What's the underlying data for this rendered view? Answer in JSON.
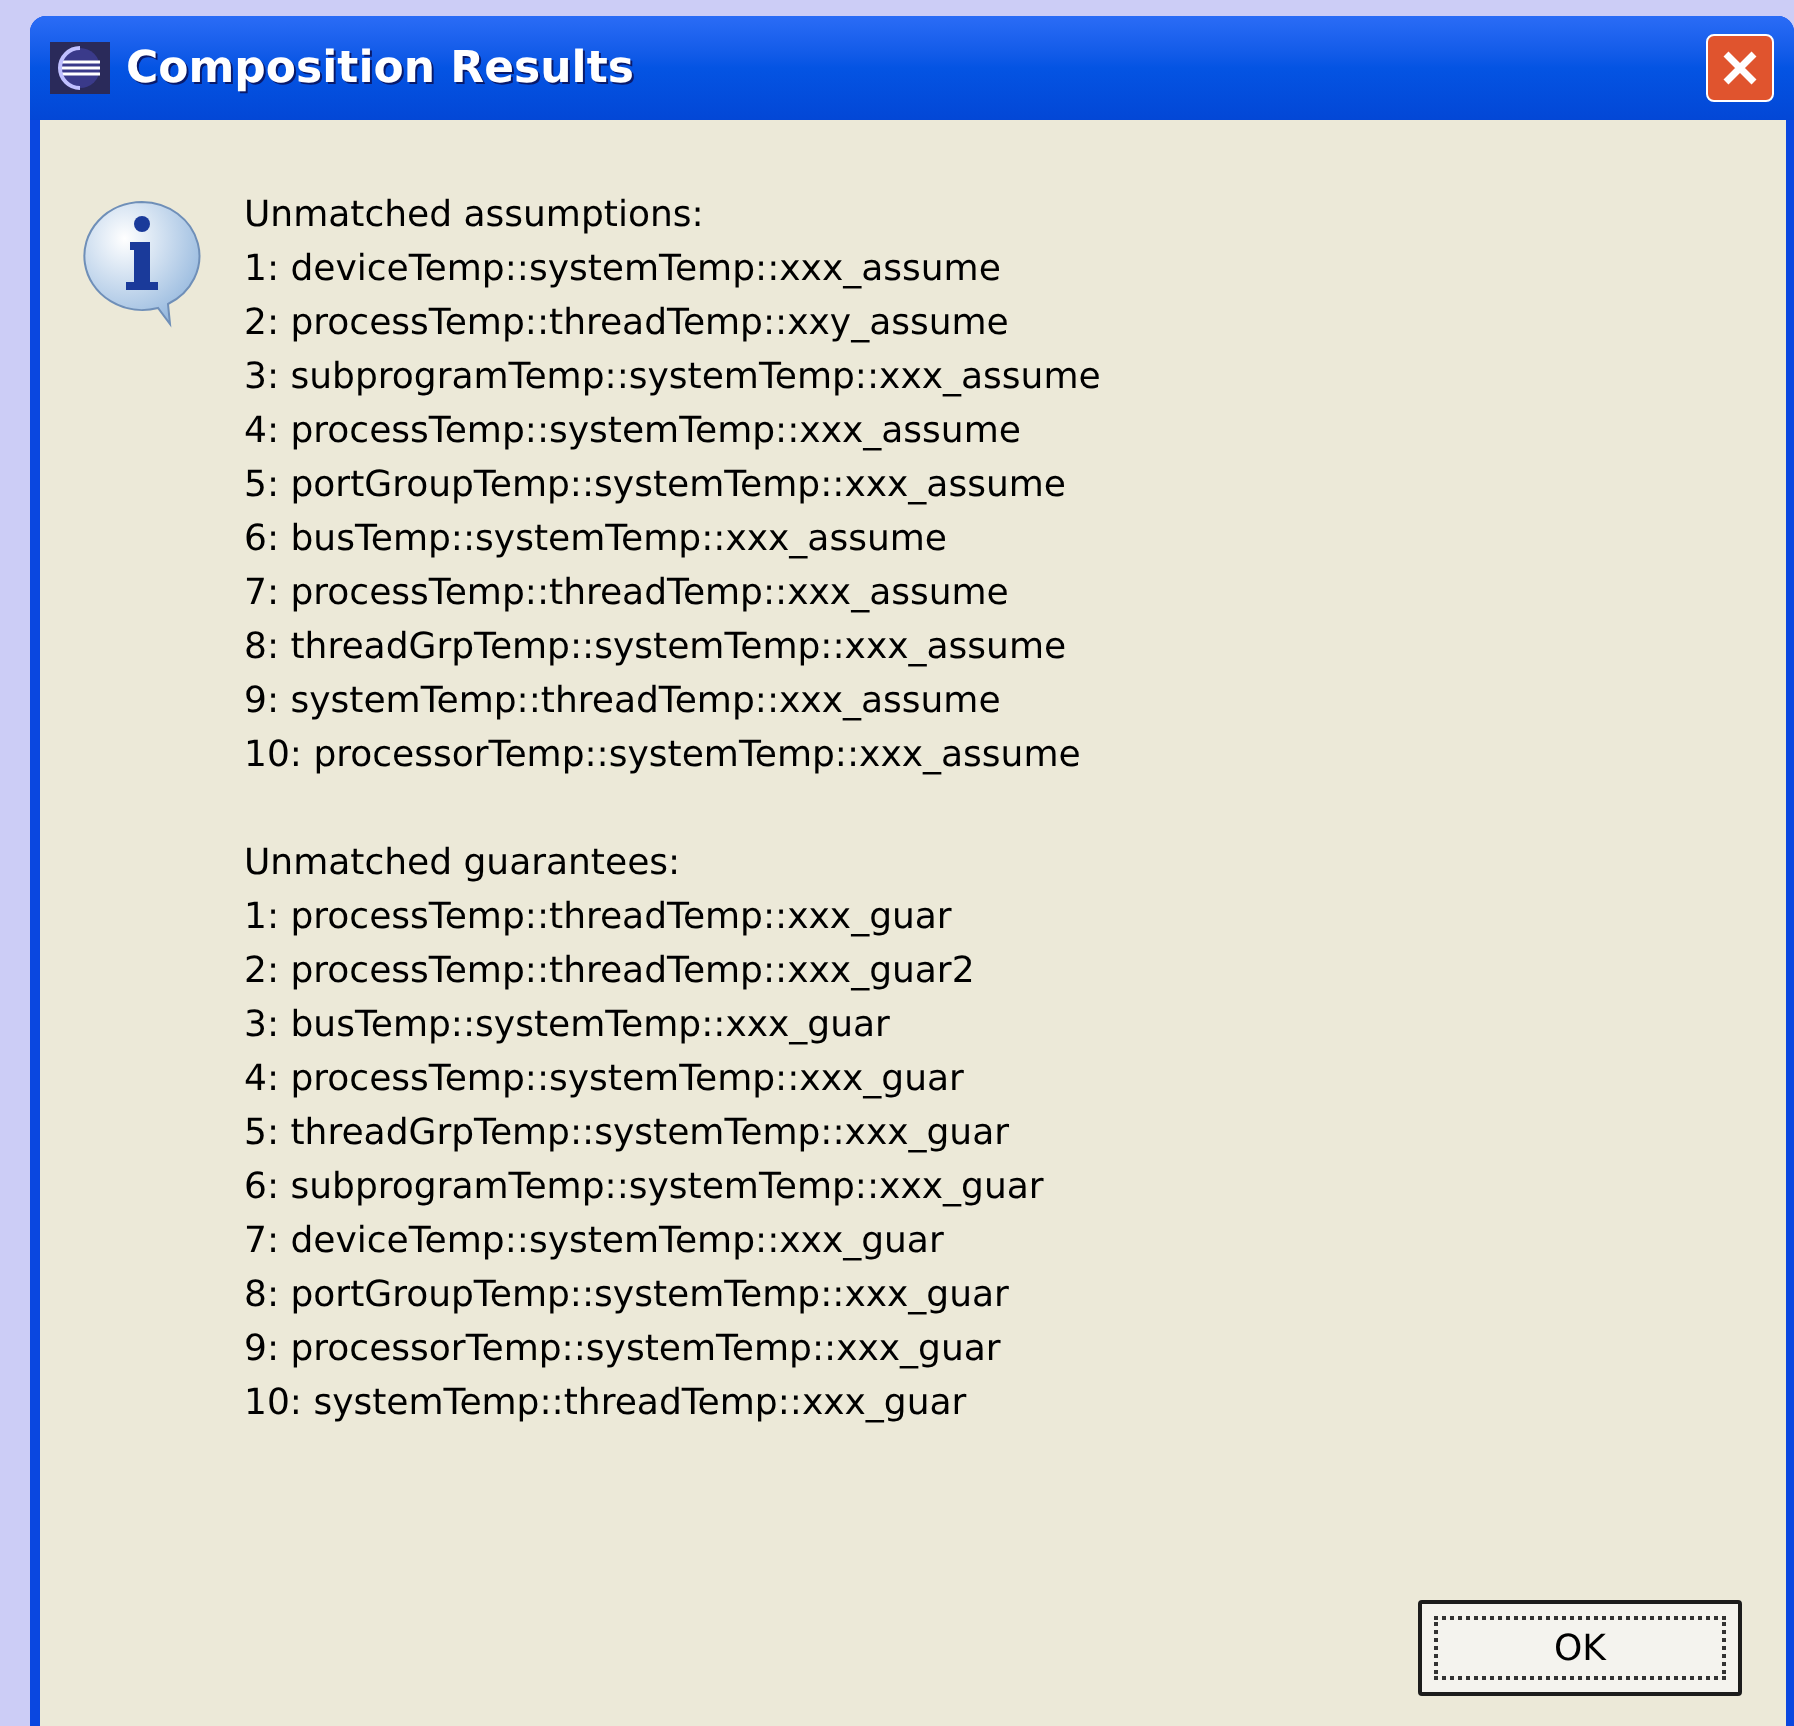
{
  "window": {
    "title": "Composition Results"
  },
  "message": {
    "sections": [
      {
        "heading": "Unmatched assumptions:",
        "lines": [
          "1: deviceTemp::systemTemp::xxx_assume",
          "2: processTemp::threadTemp::xxy_assume",
          "3: subprogramTemp::systemTemp::xxx_assume",
          "4: processTemp::systemTemp::xxx_assume",
          "5: portGroupTemp::systemTemp::xxx_assume",
          "6: busTemp::systemTemp::xxx_assume",
          "7: processTemp::threadTemp::xxx_assume",
          "8: threadGrpTemp::systemTemp::xxx_assume",
          "9: systemTemp::threadTemp::xxx_assume",
          "10: processorTemp::systemTemp::xxx_assume"
        ]
      },
      {
        "heading": "Unmatched guarantees:",
        "lines": [
          "1: processTemp::threadTemp::xxx_guar",
          "2: processTemp::threadTemp::xxx_guar2",
          "3: busTemp::systemTemp::xxx_guar",
          "4: processTemp::systemTemp::xxx_guar",
          "5: threadGrpTemp::systemTemp::xxx_guar",
          "6: subprogramTemp::systemTemp::xxx_guar",
          "7: deviceTemp::systemTemp::xxx_guar",
          "8: portGroupTemp::systemTemp::xxx_guar",
          "9: processorTemp::systemTemp::xxx_guar",
          "10: systemTemp::threadTemp::xxx_guar"
        ]
      }
    ]
  },
  "buttons": [
    {
      "label": "OK",
      "focused": true
    }
  ]
}
